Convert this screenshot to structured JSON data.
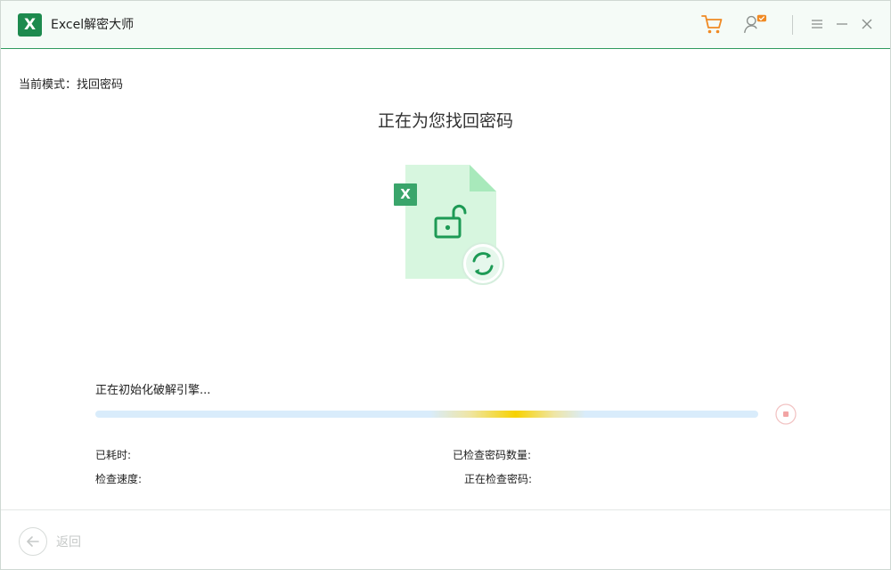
{
  "app": {
    "logo_letter": "X",
    "title": "Excel解密大师"
  },
  "titlebar": {
    "icons": [
      "cart-icon",
      "user-icon",
      "menu-icon",
      "minimize-icon",
      "close-icon"
    ],
    "accent_color": "#f08a24"
  },
  "mode": {
    "label": "当前模式：找回密码"
  },
  "main": {
    "title": "正在为您找回密码",
    "illustration_badge": "X",
    "status": "正在初始化破解引擎...",
    "stats": {
      "elapsed_label": "已耗时:",
      "checked_count_label": "已检查密码数量:",
      "speed_label": "检查速度:",
      "current_label": "正在检查密码:"
    }
  },
  "footer": {
    "back_label": "返回"
  },
  "colors": {
    "brand": "#1d8a4e",
    "progress_track": "#d9ecfb",
    "progress_highlight": "#f7d200",
    "stop_icon": "#f2a4a4"
  }
}
